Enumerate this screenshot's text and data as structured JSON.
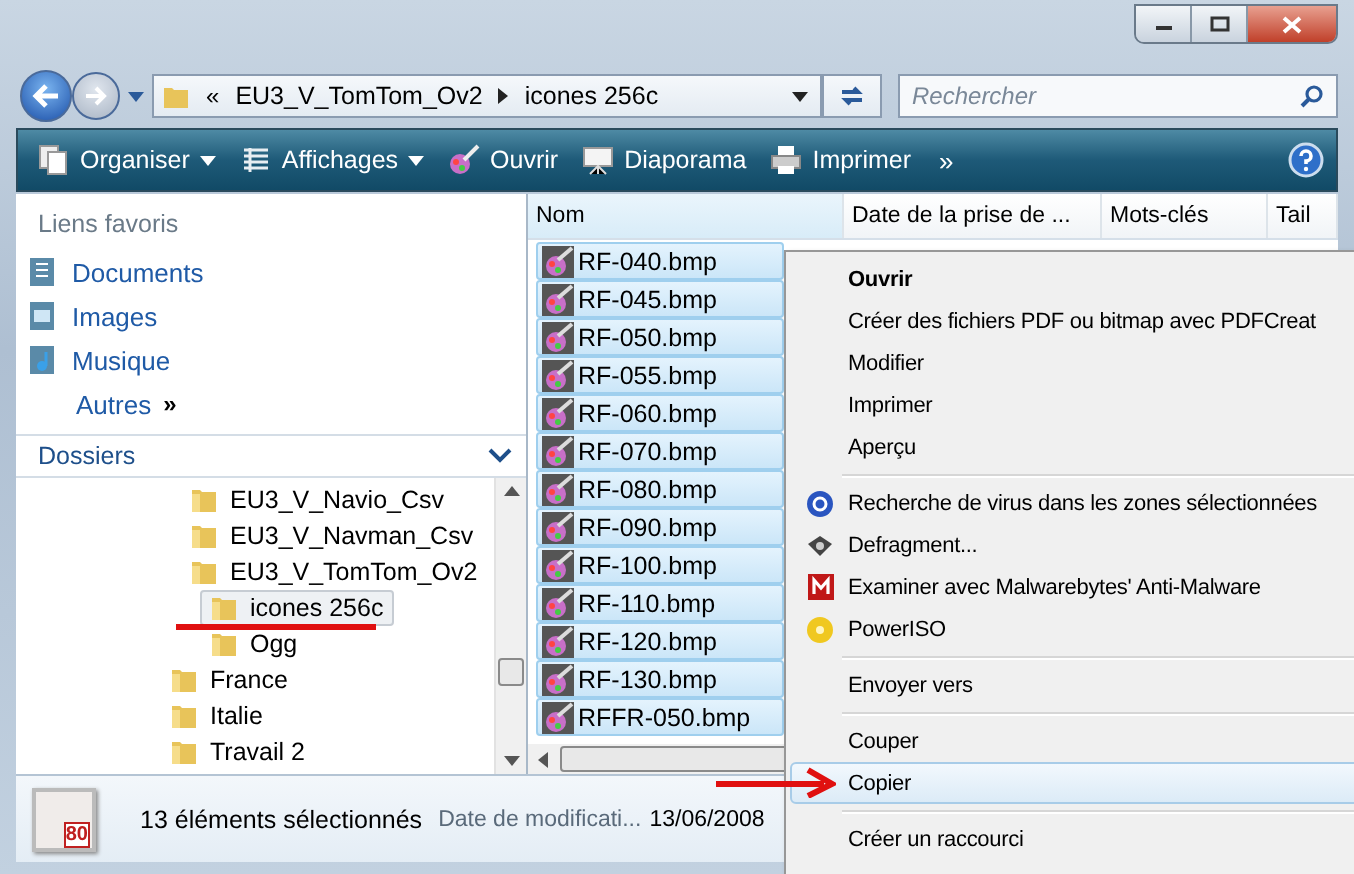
{
  "nav": {
    "path": [
      {
        "label": "EU3_V_TomTom_Ov2"
      },
      {
        "label": "icones 256c"
      }
    ],
    "overflow": "«",
    "search": {
      "placeholder": "Rechercher"
    }
  },
  "toolbar": {
    "items": [
      {
        "label": "Organiser",
        "dropdown": true
      },
      {
        "label": "Affichages",
        "dropdown": true
      },
      {
        "label": "Ouvrir",
        "dropdown": false
      },
      {
        "label": "Diaporama",
        "dropdown": false
      },
      {
        "label": "Imprimer",
        "dropdown": false
      }
    ],
    "more": "»"
  },
  "favorites": {
    "title": "Liens favoris",
    "items": [
      {
        "label": "Documents"
      },
      {
        "label": "Images"
      },
      {
        "label": "Musique"
      }
    ],
    "more": {
      "label": "Autres",
      "glyph": "»"
    }
  },
  "folders": {
    "title": "Dossiers",
    "tree": [
      {
        "children": [
          {
            "label": "EU3_V_Navio_Csv",
            "selected": false
          },
          {
            "label": "EU3_V_Navman_Csv",
            "selected": false
          },
          {
            "label": "EU3_V_TomTom_Ov2",
            "selected": false,
            "children": [
              {
                "label": "icones 256c",
                "selected": true
              },
              {
                "label": "Ogg",
                "selected": false
              }
            ]
          }
        ]
      },
      {
        "label": "France",
        "selected": false
      },
      {
        "label": "Italie",
        "selected": false
      },
      {
        "label": "Travail 2",
        "selected": false
      }
    ]
  },
  "table": {
    "columns": [
      "Nom",
      "Date de la prise de ...",
      "Mots-clés",
      "Tail"
    ],
    "rows": [
      {
        "name": "RF-040.bmp",
        "selected": true
      },
      {
        "name": "RF-045.bmp",
        "selected": true
      },
      {
        "name": "RF-050.bmp",
        "selected": true
      },
      {
        "name": "RF-055.bmp",
        "selected": true
      },
      {
        "name": "RF-060.bmp",
        "selected": true
      },
      {
        "name": "RF-070.bmp",
        "selected": true
      },
      {
        "name": "RF-080.bmp",
        "selected": true
      },
      {
        "name": "RF-090.bmp",
        "selected": true
      },
      {
        "name": "RF-100.bmp",
        "selected": true
      },
      {
        "name": "RF-110.bmp",
        "selected": true
      },
      {
        "name": "RF-120.bmp",
        "selected": true
      },
      {
        "name": "RF-130.bmp",
        "selected": true
      },
      {
        "name": "RFFR-050.bmp",
        "selected": true
      }
    ]
  },
  "status_bar": {
    "thumbnail_text": "80",
    "count": "13 éléments sélectionnés",
    "field_label": "Date de modificati...",
    "field_value": "13/06/2008"
  },
  "context_menu": [
    {
      "kind": "item",
      "label": "Ouvrir",
      "default": true,
      "selected": false
    },
    {
      "kind": "item",
      "label": "Créer des fichiers PDF ou bitmap avec PDFCreat",
      "default": false,
      "selected": false
    },
    {
      "kind": "item",
      "label": "Modifier",
      "default": false,
      "selected": false
    },
    {
      "kind": "item",
      "label": "Imprimer",
      "default": false,
      "selected": false
    },
    {
      "kind": "item",
      "label": "Aperçu",
      "default": false,
      "selected": false
    },
    {
      "kind": "separator"
    },
    {
      "kind": "item",
      "label": "Recherche de virus dans les zones sélectionnées",
      "default": false,
      "selected": false
    },
    {
      "kind": "item",
      "label": "Defragment...",
      "default": false,
      "selected": false
    },
    {
      "kind": "item",
      "label": "Examiner avec Malwarebytes' Anti-Malware",
      "default": false,
      "selected": false
    },
    {
      "kind": "item",
      "label": "PowerISO",
      "default": false,
      "selected": false
    },
    {
      "kind": "separator"
    },
    {
      "kind": "item",
      "label": "Envoyer vers",
      "default": false,
      "selected": false
    },
    {
      "kind": "separator"
    },
    {
      "kind": "item",
      "label": "Couper",
      "default": false,
      "selected": false
    },
    {
      "kind": "item",
      "label": "Copier",
      "default": false,
      "selected": true
    },
    {
      "kind": "separator"
    },
    {
      "kind": "item",
      "label": "Créer un raccourci",
      "default": false,
      "selected": false
    }
  ]
}
